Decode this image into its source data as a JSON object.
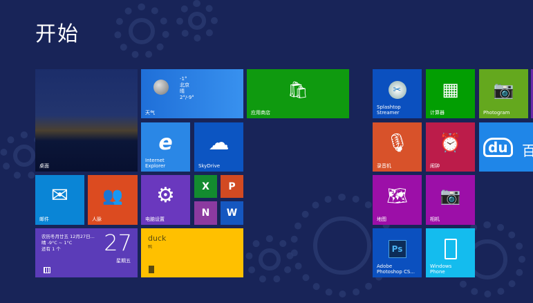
{
  "title": "开始",
  "tiles": {
    "desktop": "桌面",
    "weather": {
      "label": "天气",
      "temp": "-1°",
      "city": "北京",
      "cond": "晴",
      "range": "2°/-9°"
    },
    "store": "应用商店",
    "ie": "Internet\nExplorer",
    "skydrive": "SkyDrive",
    "mail": "邮件",
    "people": "人脉",
    "settings": "电脑设置",
    "excel": "X",
    "powerpoint": "P",
    "onenote": "N",
    "word": "W",
    "calendar": {
      "line1": "农历冬月廿五 12月27日...",
      "line2": "晴 -9°C ~ 1°C",
      "line3": "还有 1 个",
      "day": "27",
      "weekday": "星期五"
    },
    "music": {
      "title": "duck",
      "subtitle": "鸭"
    },
    "splashtop": "Splashtop\nStreamer",
    "calculator": "计算器",
    "photogram": "Photogram",
    "recorder": "录音机",
    "alarms": "闹钟",
    "baidu": {
      "logo": "du",
      "text": "百"
    },
    "maps": "地图",
    "camera": "相机",
    "photoshop": "Adobe\nPhotoshop CS...",
    "wp": "Windows\nPhone"
  }
}
